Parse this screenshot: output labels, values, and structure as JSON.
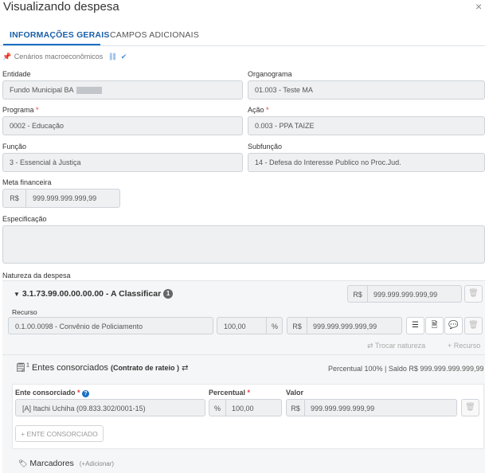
{
  "modal": {
    "title": "Visualizando despesa",
    "close": "×"
  },
  "tabs": [
    {
      "label": "INFORMAÇÕES GERAIS"
    },
    {
      "label": "CAMPOS ADICIONAIS"
    }
  ],
  "scenarios": {
    "label": "Cenários macroeconômicos"
  },
  "fields": {
    "entidade": {
      "label": "Entidade",
      "value": "Fundo Municipal BA"
    },
    "organograma": {
      "label": "Organograma",
      "value": "01.003 - Teste MA"
    },
    "programa": {
      "label": "Programa",
      "required": "*",
      "value": "0002 - Educação"
    },
    "acao": {
      "label": "Ação",
      "required": "*",
      "value": "0.003 - PPA TAIZE"
    },
    "funcao": {
      "label": "Função",
      "value": "3 - Essencial à Justiça"
    },
    "subfuncao": {
      "label": "Subfunção",
      "value": "14 - Defesa do Interesse Publico no Proc.Jud."
    },
    "meta": {
      "label": "Meta financeira",
      "prefix": "R$",
      "value": "999.999.999.999,99"
    },
    "especificacao": {
      "label": "Especificação",
      "value": ""
    }
  },
  "natureza": {
    "section_label": "Natureza da despesa",
    "title": "3.1.73.99.00.00.00.00 - A Classificar",
    "badge": "1",
    "total_prefix": "R$",
    "total": "999.999.999.999,99",
    "recurso": {
      "label": "Recurso",
      "value": "0.1.00.0098 - Convênio de Policiamento",
      "percent": "100,00",
      "percent_unit": "%",
      "money_prefix": "R$",
      "money": "999.999.999.999,99"
    },
    "trocar": "Trocar natureza",
    "add_recurso": "+ Recurso"
  },
  "entes": {
    "badge": "1",
    "title": "Entes consorciados",
    "subtitle": "(Contrato de rateio )",
    "summary": "Percentual 100% | Saldo R$ 999.999.999.999,99",
    "col_ente": "Ente consorciado",
    "col_percent": "Percentual",
    "col_valor": "Valor",
    "required": "*",
    "row": {
      "ente": "[A] Itachi Uchiha (09.833.302/0001-15)",
      "percent_unit": "%",
      "percent": "100,00",
      "valor_prefix": "R$",
      "valor": "999.999.999.999,99"
    },
    "add_button": "+ ENTE CONSORCIADO"
  },
  "marcadores": {
    "label": "Marcadores",
    "add": "(+Adicionar)"
  }
}
